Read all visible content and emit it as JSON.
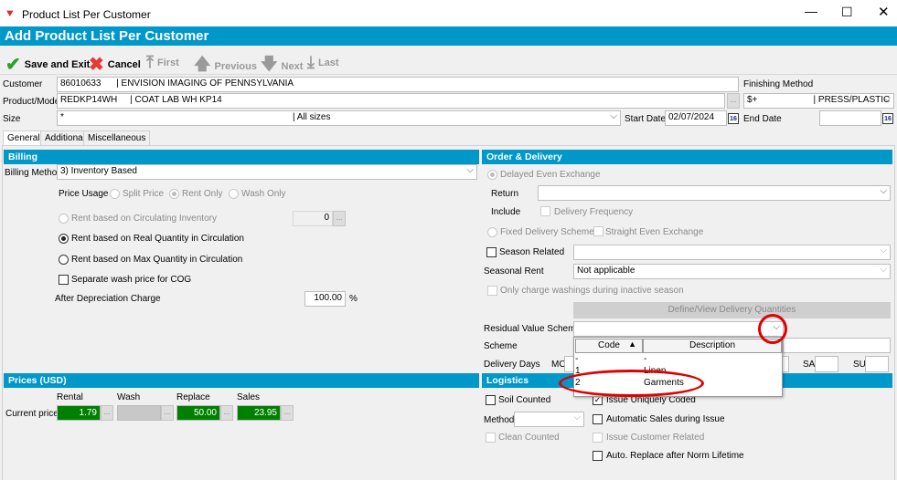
{
  "window": {
    "title": "Product List Per Customer",
    "header": "Add Product List Per Customer"
  },
  "toolbar": {
    "save": "Save and Exit",
    "cancel": "Cancel",
    "first": "First",
    "previous": "Previous",
    "next": "Next",
    "last": "Last"
  },
  "form": {
    "customer_label": "Customer",
    "customer_value": "86010633      | ENVISION IMAGING OF PENNSYLVANIA",
    "product_label": "Product/Model",
    "product_value": "REDKP14WH     | COAT LAB WH KP14",
    "size_label": "Size",
    "size_value": "*                                                                                          | All sizes",
    "finishing_label": "Finishing Method",
    "finishing_value": "$+                      | PRESS/PLASTIC",
    "start_label": "Start Date",
    "start_value": "02/07/2024",
    "end_label": "End Date",
    "end_value": "",
    "cal": "16",
    "dots": "..."
  },
  "tabs": [
    "General",
    "Additional",
    "Miscellaneous"
  ],
  "billing": {
    "title": "Billing",
    "method_label": "Billing Method",
    "method_value": "3) Inventory Based",
    "price_usage": "Price Usage",
    "split": "Split Price",
    "rent_only": "Rent Only",
    "wash_only": "Wash Only",
    "rent_circ": "Rent based on Circulating Inventory",
    "rent_circ_value": "0",
    "rent_real": "Rent based on Real Quantity in Circulation",
    "rent_max": "Rent based on Max Quantity in Circulation",
    "separate": "Separate wash price for COG",
    "after_dep": "After Depreciation Charge",
    "after_dep_value": "100.00",
    "pct": "%"
  },
  "prices": {
    "title": "Prices (USD)",
    "row_label": "Current price",
    "cols": [
      {
        "label": "Rental",
        "value": "1.79"
      },
      {
        "label": "Wash",
        "value": ""
      },
      {
        "label": "Replace",
        "value": "50.00"
      },
      {
        "label": "Sales",
        "value": "23.95"
      }
    ]
  },
  "order": {
    "title": "Order & Delivery",
    "delayed": "Delayed Even Exchange",
    "return": "Return",
    "include": "Include",
    "delivery_freq": "Delivery Frequency",
    "fixed": "Fixed Delivery Scheme",
    "straight": "Straight Even Exchange",
    "season_related": "Season Related",
    "seasonal_rent": "Seasonal Rent",
    "seasonal_rent_value": "Not applicable",
    "only_charge": "Only charge washings during inactive season",
    "define": "Define/View Delivery Quantities",
    "residual": "Residual Value Scheme",
    "scheme": "Scheme",
    "delivery_days": "Delivery Days",
    "mo": "MO",
    "sa": "SA",
    "su": "SU"
  },
  "dropdown": {
    "headers": [
      "Code",
      "Description"
    ],
    "rows": [
      {
        "code": "-",
        "desc": "-"
      },
      {
        "code": "1",
        "desc": "Linen"
      },
      {
        "code": "2",
        "desc": "Garments"
      }
    ]
  },
  "logistics": {
    "title": "Logistics",
    "soil": "Soil Counted",
    "method": "Method",
    "clean": "Clean Counted",
    "issue_unique": "Issue Uniquely Coded",
    "auto_sales": "Automatic Sales during Issue",
    "issue_customer": "Issue Customer Related",
    "auto_replace": "Auto. Replace after Norm Lifetime"
  },
  "colors": {
    "accent": "#0097c9",
    "price_green": "#008000",
    "annotation": "#e00000"
  }
}
